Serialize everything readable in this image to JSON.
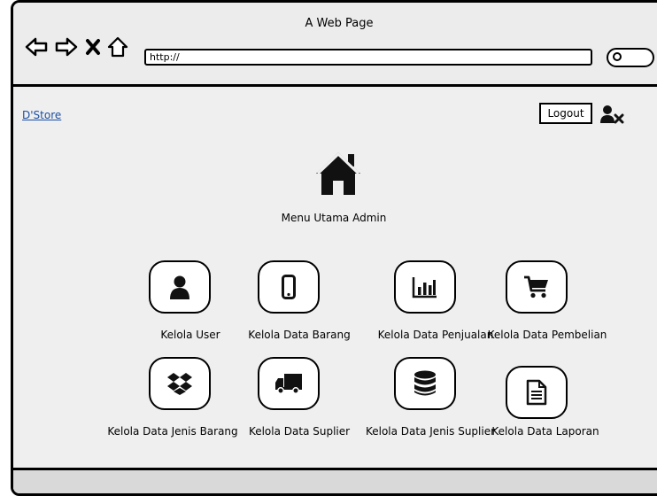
{
  "browser": {
    "window_title": "A Web Page",
    "url": "http://",
    "nav_icons": [
      "back-arrow-icon",
      "forward-arrow-icon",
      "close-icon",
      "home-outline-icon"
    ],
    "search_icon": "search-icon"
  },
  "header": {
    "brand": "D'Store",
    "logout_label": "Logout",
    "user_remove_icon": "user-remove-icon"
  },
  "main": {
    "home_icon": "home-icon",
    "title": "Menu Utama Admin"
  },
  "menu": {
    "items": [
      {
        "label": "Kelola User",
        "icon": "user-icon"
      },
      {
        "label": "Kelola Data Barang",
        "icon": "mobile-phone-icon"
      },
      {
        "label": "Kelola Data Penjualan",
        "icon": "bar-chart-icon"
      },
      {
        "label": "Kelola Data Pembelian",
        "icon": "shopping-cart-icon"
      },
      {
        "label": "Kelola Data Jenis Barang",
        "icon": "dropbox-icon"
      },
      {
        "label": "Kelola Data Suplier",
        "icon": "truck-icon"
      },
      {
        "label": "Kelola Data Jenis Suplier",
        "icon": "database-icon"
      },
      {
        "label": "Kelola Data Laporan",
        "icon": "document-icon"
      }
    ]
  }
}
